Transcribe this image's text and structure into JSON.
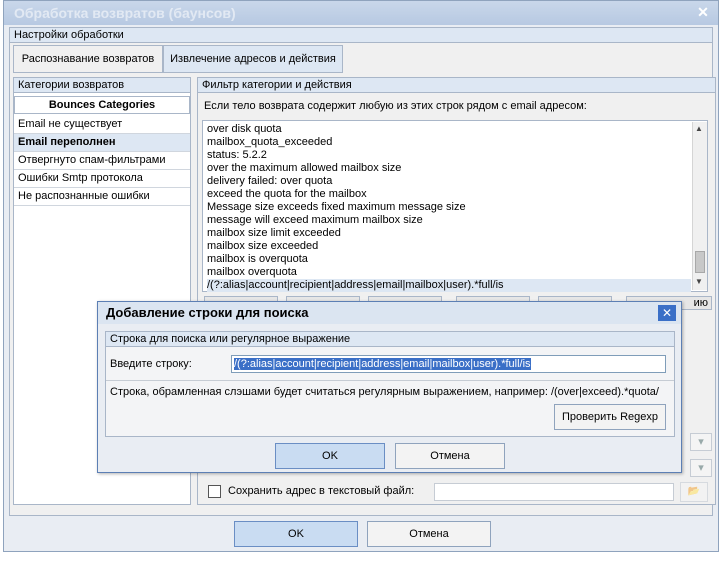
{
  "window": {
    "title": "Обработка возвратов (баунсов)",
    "close_glyph": "✕"
  },
  "settings_group": {
    "header": "Настройки обработки"
  },
  "tabs": [
    {
      "label": "Распознавание возвратов"
    },
    {
      "label": "Извлечение адресов и действия"
    }
  ],
  "categories": {
    "header": "Категории возвратов",
    "title": "Bounces Categories",
    "items": [
      {
        "label": "Email не существует"
      },
      {
        "label": "Email переполнен"
      },
      {
        "label": "Отвергнуто спам-фильтрами"
      },
      {
        "label": "Ошибки Smtp протокола"
      },
      {
        "label": "Не распознанные ошибки"
      }
    ],
    "selected_index": 1
  },
  "filter": {
    "header": "Фильтр категории и действия",
    "description": "Если тело возврата содержит любую из этих строк рядом с email адресом:",
    "lines": [
      "over disk quota",
      "mailbox_quota_exceeded",
      "status: 5.2.2",
      "over the maximum allowed mailbox size",
      "delivery failed: over quota",
      "exceed the quota for the mailbox",
      "Message size exceeds fixed maximum message size",
      "message will exceed maximum mailbox size",
      "mailbox size limit exceeded",
      "mailbox size exceeded",
      "mailbox is overquota",
      "mailbox overquota",
      "/(?:alias|account|recipient|address|email|mailbox|user).*full/is"
    ],
    "selected_line_index": 12,
    "partial_button_text": "ию",
    "save_address_label": "Сохранить адрес в текстовый файл:",
    "save_address_value": ""
  },
  "dialog": {
    "title": "Добавление строки для поиска",
    "group_header": "Строка для поиска или регулярное выражение",
    "input_label": "Введите строку:",
    "input_value": "/(?:alias|account|recipient|address|email|mailbox|user).*full/is",
    "hint": "Строка, обрамленная слэшами будет считаться регулярным выражением, например:  /(over|exceed).*quota/",
    "check_regexp_label": "Проверить Regexp",
    "ok_label": "OK",
    "cancel_label": "Отмена",
    "close_glyph": "✕"
  },
  "footer": {
    "ok_label": "OK",
    "cancel_label": "Отмена"
  },
  "icons": {
    "scroll_up": "▲",
    "scroll_down": "▼",
    "dropdown": "▾",
    "folder": "📂"
  }
}
